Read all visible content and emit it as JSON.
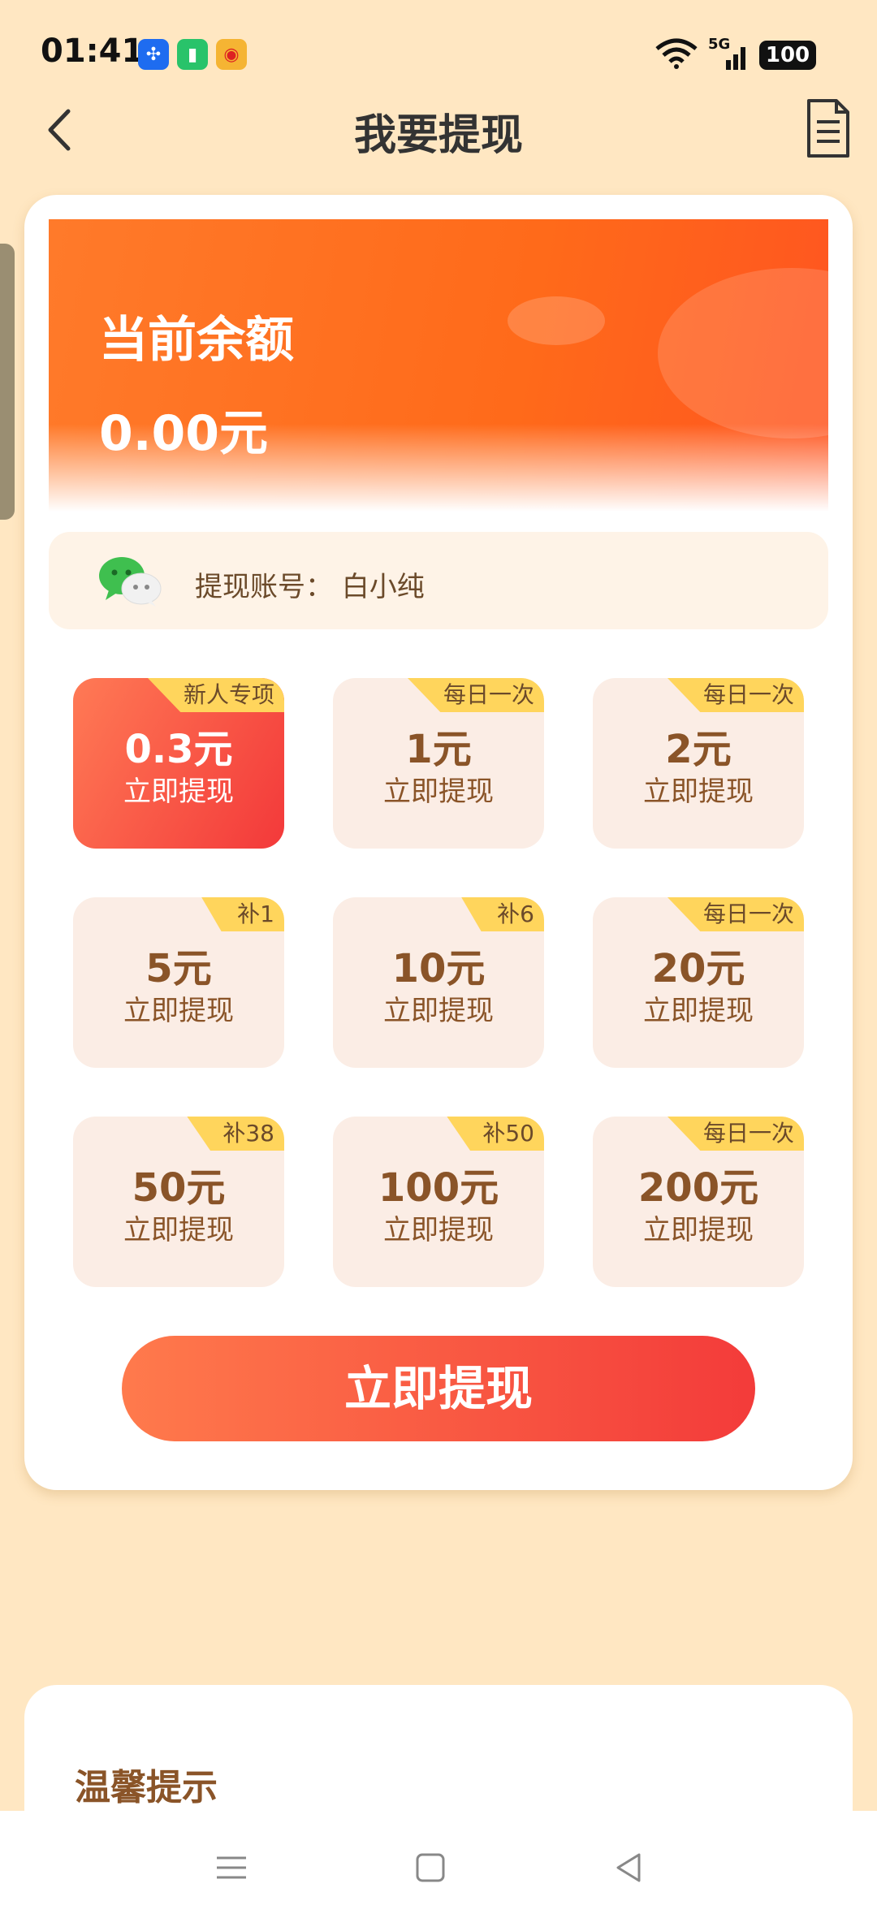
{
  "status_bar": {
    "time": "01:41",
    "battery": "100",
    "network": "5G"
  },
  "header": {
    "title": "我要提现",
    "back_icon": "chevron-left-icon",
    "doc_icon": "document-icon"
  },
  "balance": {
    "label": "当前余额",
    "value": "0.00元"
  },
  "account": {
    "label": "提现账号：  白小纯",
    "icon": "wechat-icon"
  },
  "options": [
    {
      "tag": "新人专项",
      "amount": "0.3元",
      "action": "立即提现",
      "selected": true
    },
    {
      "tag": "每日一次",
      "amount": "1元",
      "action": "立即提现",
      "selected": false
    },
    {
      "tag": "每日一次",
      "amount": "2元",
      "action": "立即提现",
      "selected": false
    },
    {
      "tag": "补1",
      "amount": "5元",
      "action": "立即提现",
      "selected": false
    },
    {
      "tag": "补6",
      "amount": "10元",
      "action": "立即提现",
      "selected": false
    },
    {
      "tag": "每日一次",
      "amount": "20元",
      "action": "立即提现",
      "selected": false
    },
    {
      "tag": "补38",
      "amount": "50元",
      "action": "立即提现",
      "selected": false
    },
    {
      "tag": "补50",
      "amount": "100元",
      "action": "立即提现",
      "selected": false
    },
    {
      "tag": "每日一次",
      "amount": "200元",
      "action": "立即提现",
      "selected": false
    }
  ],
  "withdraw_button": "立即提现",
  "tips": {
    "title": "温馨提示"
  },
  "colors": {
    "page_bg": "#FFE7C2",
    "accent": "#F33B3A",
    "banner": "#FF6A1A",
    "tag": "#FFD55C",
    "text_brown": "#8A5428"
  }
}
